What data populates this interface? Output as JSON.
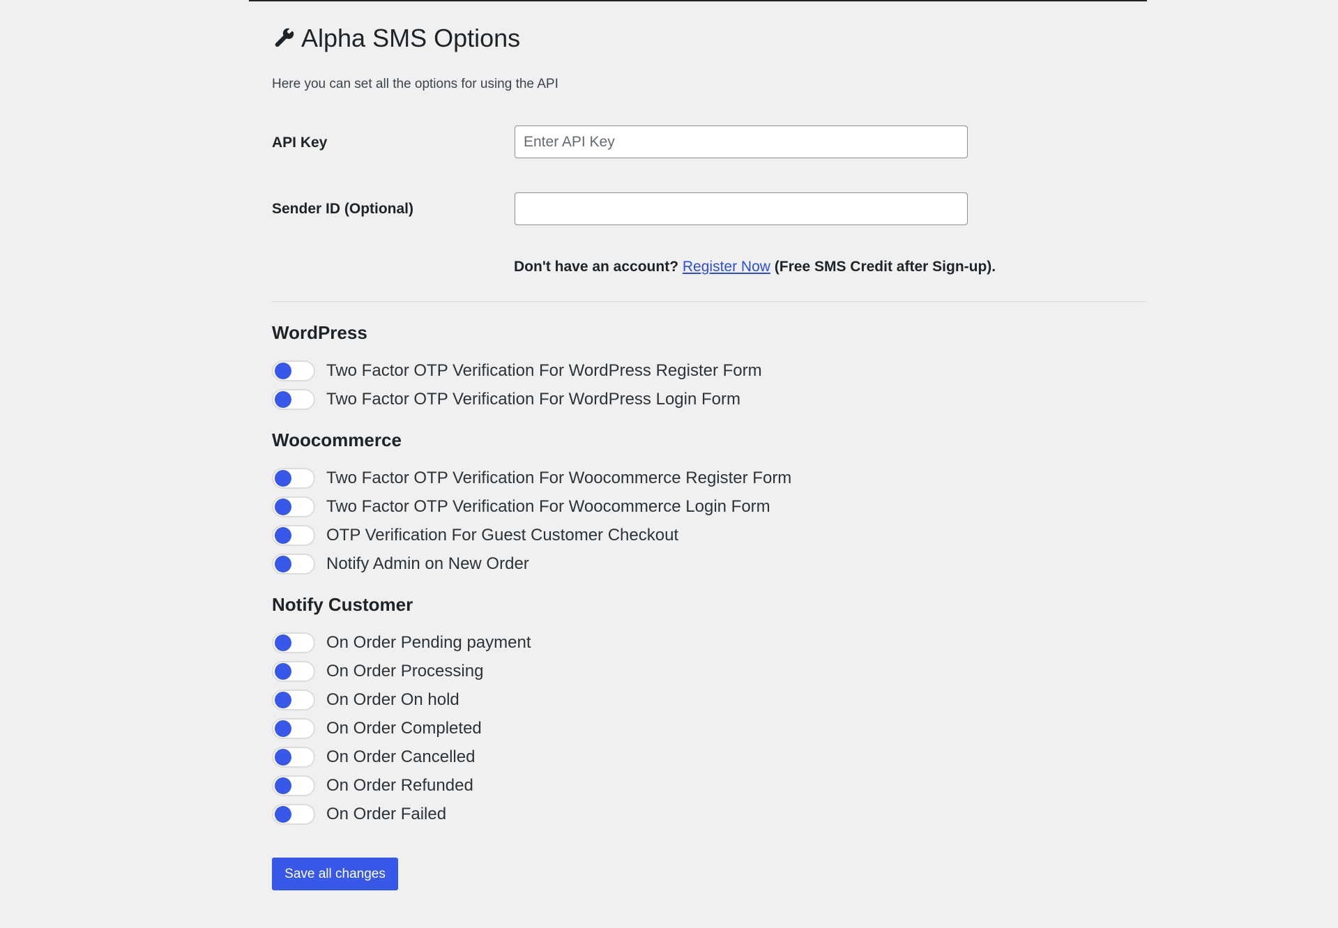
{
  "page": {
    "title": "Alpha SMS Options",
    "subtitle": "Here you can set all the options for using the API",
    "title_icon": "wrench-icon"
  },
  "fields": {
    "api_key": {
      "label": "API Key",
      "value": "",
      "placeholder": "Enter API Key"
    },
    "sender_id": {
      "label": "Sender ID (Optional)",
      "value": "",
      "placeholder": ""
    }
  },
  "register": {
    "prefix": "Don't have an account?",
    "link_text": "Register Now",
    "suffix": "(Free SMS Credit after Sign-up)."
  },
  "sections": {
    "wordpress": {
      "heading": "WordPress",
      "items": [
        {
          "label": "Two Factor OTP Verification For WordPress Register Form",
          "enabled": false
        },
        {
          "label": "Two Factor OTP Verification For WordPress Login Form",
          "enabled": false
        }
      ]
    },
    "woocommerce": {
      "heading": "Woocommerce",
      "items": [
        {
          "label": "Two Factor OTP Verification For Woocommerce Register Form",
          "enabled": false
        },
        {
          "label": "Two Factor OTP Verification For Woocommerce Login Form",
          "enabled": false
        },
        {
          "label": "OTP Verification For Guest Customer Checkout",
          "enabled": false
        },
        {
          "label": "Notify Admin on New Order",
          "enabled": false
        }
      ]
    },
    "notify_customer": {
      "heading": "Notify Customer",
      "items": [
        {
          "label": "On Order Pending payment",
          "enabled": false
        },
        {
          "label": "On Order Processing",
          "enabled": false
        },
        {
          "label": "On Order On hold",
          "enabled": false
        },
        {
          "label": "On Order Completed",
          "enabled": false
        },
        {
          "label": "On Order Cancelled",
          "enabled": false
        },
        {
          "label": "On Order Refunded",
          "enabled": false
        },
        {
          "label": "On Order Failed",
          "enabled": false
        }
      ]
    }
  },
  "actions": {
    "save_label": "Save all changes"
  },
  "colors": {
    "accent": "#3858e9",
    "link": "#2c4ee0",
    "background": "#f0f0f1"
  }
}
